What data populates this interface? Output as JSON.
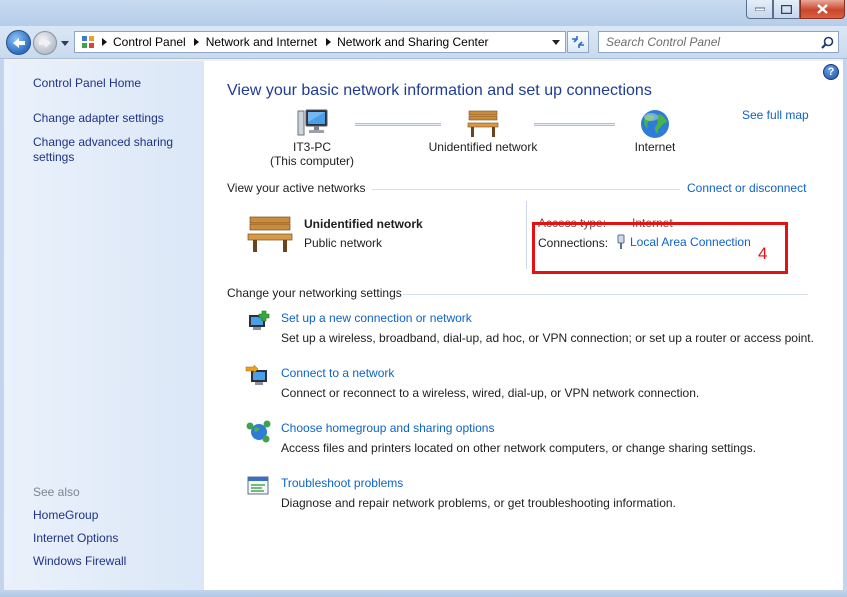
{
  "address": {
    "crumbs": [
      "Control Panel",
      "Network and Internet",
      "Network and Sharing Center"
    ],
    "search_placeholder": "Search Control Panel"
  },
  "sidebar": {
    "home": "Control Panel Home",
    "links": [
      "Change adapter settings",
      "Change advanced sharing settings"
    ],
    "see_also_label": "See also",
    "see_also": [
      "HomeGroup",
      "Internet Options",
      "Windows Firewall"
    ]
  },
  "main": {
    "heading": "View your basic network information and set up connections",
    "see_full_map": "See full map",
    "map": {
      "computer_name": "IT3-PC",
      "computer_note": "(This computer)",
      "network": "Unidentified network",
      "internet": "Internet"
    },
    "active": {
      "title": "View your active networks",
      "connect_link": "Connect or disconnect",
      "network_name": "Unidentified network",
      "network_category": "Public network",
      "access_type_label": "Access type:",
      "access_type_value": "Internet",
      "connections_label": "Connections:",
      "connection_link": "Local Area Connection"
    },
    "annotation_number": "4",
    "settings_title": "Change your networking settings",
    "tasks": [
      {
        "link": "Set up a new connection or network",
        "desc": "Set up a wireless, broadband, dial-up, ad hoc, or VPN connection; or set up a router or access point."
      },
      {
        "link": "Connect to a network",
        "desc": "Connect or reconnect to a wireless, wired, dial-up, or VPN network connection."
      },
      {
        "link": "Choose homegroup and sharing options",
        "desc": "Access files and printers located on other network computers, or change sharing settings."
      },
      {
        "link": "Troubleshoot problems",
        "desc": "Diagnose and repair network problems, or get troubleshooting information."
      }
    ]
  },
  "colors": {
    "link": "#0e63c8",
    "heading": "#1e3c96",
    "annotation": "#e41212"
  }
}
